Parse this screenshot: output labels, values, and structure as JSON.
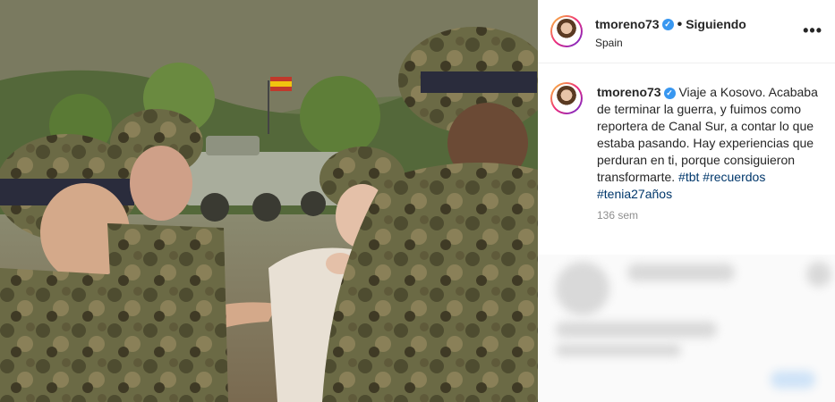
{
  "post": {
    "header": {
      "username": "tmoreno73",
      "verified_mark": "✓",
      "separator": "•",
      "follow_status": "Siguiendo",
      "location": "Spain",
      "more_icon": "more-horizontal-icon",
      "more_label": "•••"
    },
    "caption": {
      "username": "tmoreno73",
      "verified_mark": "✓",
      "text": "Viaje a Kosovo. Acababa de terminar la guerra, y fuimos como reportera de Canal Sur, a contar lo que estaba pasando. Hay experiencias que perduran en ti, porque consiguieron transformarte.",
      "hashtags": [
        "#tbt",
        "#recuerdos",
        "#tenia27años"
      ],
      "timestamp": "136 sem"
    },
    "colors": {
      "link": "#00376b",
      "verified": "#3897f0",
      "muted": "#8e8e8e"
    }
  }
}
